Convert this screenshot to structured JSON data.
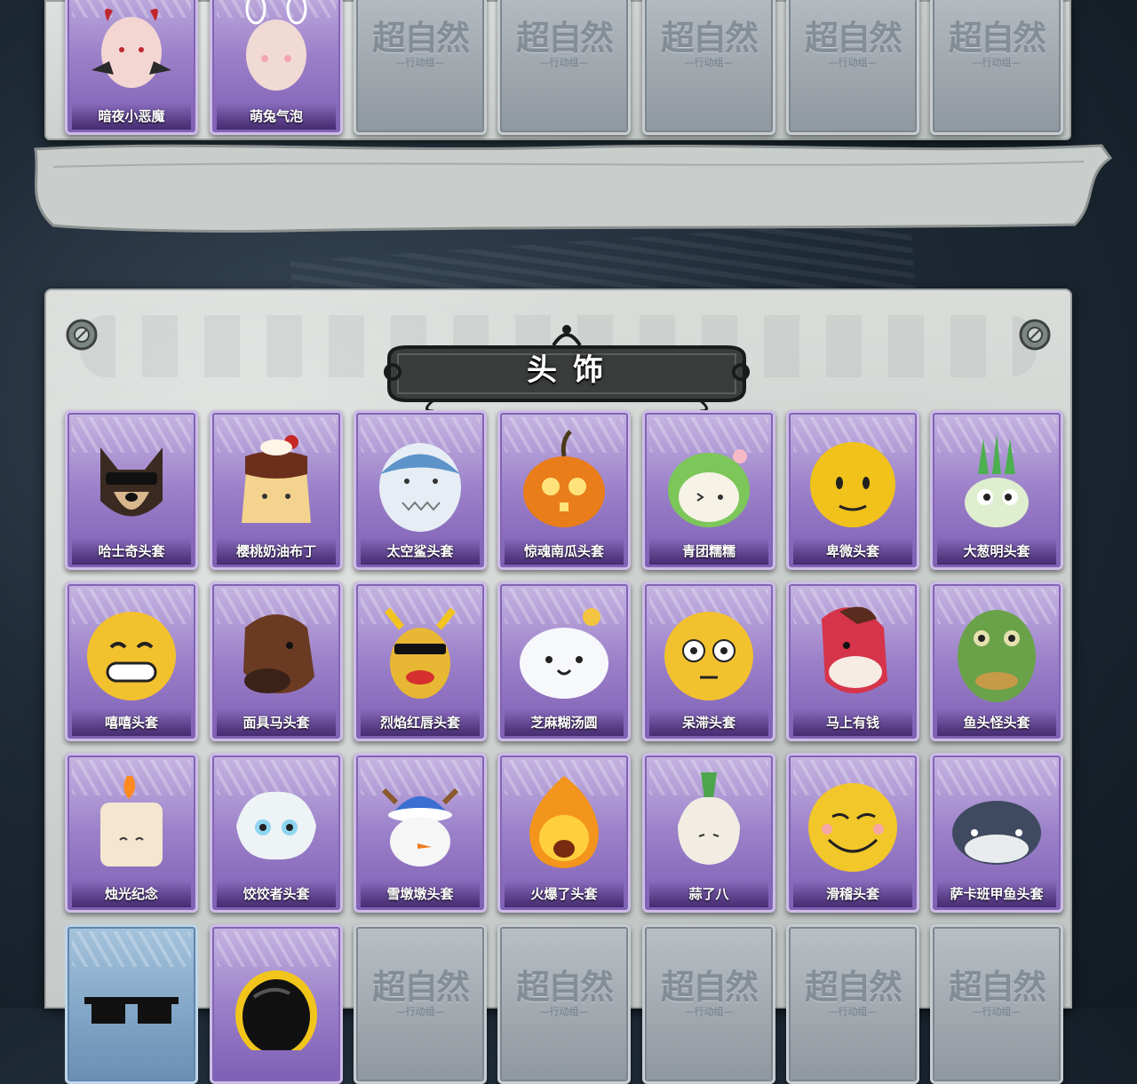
{
  "section_title": "头饰",
  "locked_mark": {
    "main": "超自然",
    "sub": "—行动组—"
  },
  "top_row": [
    {
      "name": "暗夜小恶魔",
      "owned": true,
      "icon": "devil-head-icon"
    },
    {
      "name": "萌兔气泡",
      "owned": true,
      "icon": "bunny-bubble-head-icon"
    },
    {
      "name": "",
      "owned": false
    },
    {
      "name": "",
      "owned": false
    },
    {
      "name": "",
      "owned": false
    },
    {
      "name": "",
      "owned": false
    },
    {
      "name": "",
      "owned": false
    }
  ],
  "rows": [
    [
      {
        "name": "哈士奇头套",
        "icon": "husky-icon"
      },
      {
        "name": "樱桃奶油布丁",
        "icon": "pudding-icon"
      },
      {
        "name": "太空鲨头套",
        "icon": "shark-icon"
      },
      {
        "name": "惊魂南瓜头套",
        "icon": "pumpkin-icon"
      },
      {
        "name": "青团糯糯",
        "icon": "green-dumpling-icon"
      },
      {
        "name": "卑微头套",
        "icon": "humble-emoji-icon"
      },
      {
        "name": "大葱明头套",
        "icon": "scallion-icon"
      }
    ],
    [
      {
        "name": "嘻嘻头套",
        "icon": "grin-emoji-icon"
      },
      {
        "name": "面具马头套",
        "icon": "horse-mask-icon"
      },
      {
        "name": "烈焰红唇头套",
        "icon": "red-lips-icon"
      },
      {
        "name": "芝麻糊汤圆",
        "icon": "tangyuan-icon"
      },
      {
        "name": "呆滞头套",
        "icon": "dazed-emoji-icon"
      },
      {
        "name": "马上有钱",
        "icon": "red-horse-icon"
      },
      {
        "name": "鱼头怪头套",
        "icon": "fish-head-icon"
      }
    ],
    [
      {
        "name": "烛光纪念",
        "icon": "candle-icon"
      },
      {
        "name": "饺饺者头套",
        "icon": "dumpling-icon"
      },
      {
        "name": "雪墩墩头套",
        "icon": "snowman-icon"
      },
      {
        "name": "火爆了头套",
        "icon": "fireball-icon"
      },
      {
        "name": "蒜了八",
        "icon": "garlic-icon"
      },
      {
        "name": "滑稽头套",
        "icon": "funny-emoji-icon"
      },
      {
        "name": "萨卡班甲鱼头套",
        "icon": "sacabambaspis-icon"
      }
    ]
  ],
  "bottom_row": [
    {
      "name": "",
      "owned": true,
      "style": "blue",
      "icon": "pixel-sunglasses-icon"
    },
    {
      "name": "",
      "owned": true,
      "style": "purple",
      "icon": "helmet-icon"
    },
    {
      "name": "",
      "owned": false
    },
    {
      "name": "",
      "owned": false
    },
    {
      "name": "",
      "owned": false
    },
    {
      "name": "",
      "owned": false
    },
    {
      "name": "",
      "owned": false
    }
  ],
  "colors": {
    "owned_frame": "#9b80c9",
    "locked_frame": "#8f979e",
    "blue_frame": "#7fa3c4",
    "background": "#1e2a36"
  }
}
